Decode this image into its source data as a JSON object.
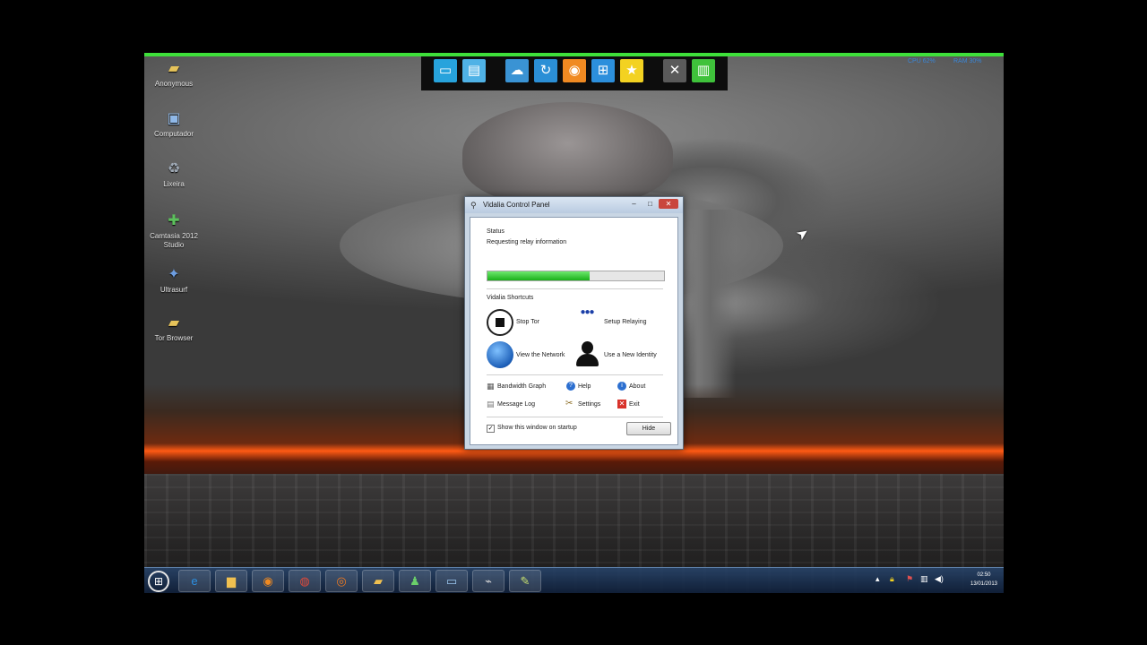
{
  "desktop": {
    "icons": [
      {
        "label": "Anonymous",
        "glyph": "folder-icon",
        "color": "#e6c35a"
      },
      {
        "label": "Computador",
        "glyph": "computer-icon",
        "color": "#8fb8e8"
      },
      {
        "label": "Lixeira",
        "glyph": "recycle-bin-icon",
        "color": "#9ea8b4"
      },
      {
        "label": "Camtasia 2012 Studio",
        "glyph": "camtasia-icon",
        "color": "#5cc05c"
      },
      {
        "label": "Ultrasurf",
        "glyph": "ultrasurf-icon",
        "color": "#6d9de0"
      },
      {
        "label": "Tor Browser",
        "glyph": "folder-icon",
        "color": "#e6c35a"
      }
    ]
  },
  "dock": {
    "items": [
      {
        "name": "desktop-icon",
        "glyph": "▭",
        "color": "#27a3dc"
      },
      {
        "name": "window-icon",
        "glyph": "▤",
        "color": "#4fb2e6"
      },
      {
        "name": "chat-icon",
        "glyph": "☁",
        "color": "#3a93d4"
      },
      {
        "name": "sync-icon",
        "glyph": "↻",
        "color": "#2b8fd6"
      },
      {
        "name": "media-icon",
        "glyph": "◉",
        "color": "#f08a22"
      },
      {
        "name": "windows-icon",
        "glyph": "⊞",
        "color": "#2c8fdc"
      },
      {
        "name": "star-icon",
        "glyph": "★",
        "color": "#f3d221"
      },
      {
        "name": "tools-icon",
        "glyph": "✕",
        "color": "#5a5a5a"
      },
      {
        "name": "battery-icon",
        "glyph": "▥",
        "color": "#3fc23b"
      }
    ],
    "cpu": "CPU 62%",
    "ram": "RAM 30%"
  },
  "vidalia": {
    "title": "Vidalia Control Panel",
    "status_heading": "Status",
    "status_text": "Requesting relay information",
    "progress_fraction": 0.58,
    "shortcuts_heading": "Vidalia Shortcuts",
    "stop_tor": "Stop Tor",
    "setup_relaying": "Setup Relaying",
    "view_network": "View the Network",
    "new_identity": "Use a New Identity",
    "bandwidth_graph": "Bandwidth Graph",
    "help": "Help",
    "about": "About",
    "message_log": "Message Log",
    "settings": "Settings",
    "exit": "Exit",
    "show_on_startup": "Show this window on startup",
    "hide": "Hide"
  },
  "taskbar": {
    "items": [
      {
        "name": "ie-icon",
        "glyph": "e",
        "color": "#2c8fe0"
      },
      {
        "name": "explorer-icon",
        "glyph": "▆",
        "color": "#f0c050"
      },
      {
        "name": "media-player-icon",
        "glyph": "◉",
        "color": "#f08a22"
      },
      {
        "name": "chrome-icon",
        "glyph": "◍",
        "color": "#e04a3a"
      },
      {
        "name": "firefox-icon",
        "glyph": "◎",
        "color": "#f07a20"
      },
      {
        "name": "folder-icon",
        "glyph": "▰",
        "color": "#f0c050"
      },
      {
        "name": "users-icon",
        "glyph": "♟",
        "color": "#6ad06a"
      },
      {
        "name": "window-icon",
        "glyph": "▭",
        "color": "#9bc6ee"
      },
      {
        "name": "network-icon",
        "glyph": "⌁",
        "color": "#d8d8d8"
      },
      {
        "name": "vidalia-icon",
        "glyph": "✎",
        "color": "#c8e070"
      }
    ],
    "time": "02:50",
    "date": "13/01/2013"
  }
}
